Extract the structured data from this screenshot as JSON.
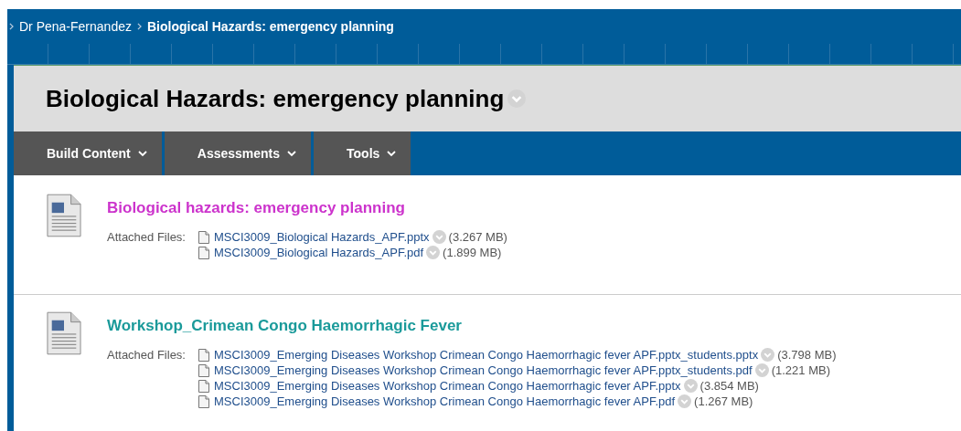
{
  "breadcrumb": [
    {
      "label": "Dr Pena-Fernandez",
      "selected": false
    },
    {
      "label": "Biological Hazards: emergency planning",
      "selected": true
    }
  ],
  "page_title": "Biological Hazards: emergency planning",
  "toolbar": [
    "Build Content",
    "Assessments",
    "Tools"
  ],
  "items": [
    {
      "title": "Biological hazards: emergency planning",
      "color": "#cc33cc",
      "files_label": "Attached Files:",
      "files": [
        {
          "name": "MSCI3009_Biological Hazards_APF.pptx",
          "size": "(3.267 MB)"
        },
        {
          "name": "MSCI3009_Biological Hazards_APF.pdf",
          "size": "(1.899 MB)"
        }
      ]
    },
    {
      "title": "Workshop_Crimean Congo Haemorrhagic Fever",
      "color": "#1a9a9a",
      "files_label": "Attached Files:",
      "files": [
        {
          "name": "MSCI3009_Emerging Diseases Workshop Crimean Congo Haemorrhagic fever APF.pptx_students.pptx",
          "size": "(3.798 MB)"
        },
        {
          "name": "MSCI3009_Emerging Diseases Workshop Crimean Congo Haemorrhagic fever APF.pptx_students.pdf",
          "size": "(1.221 MB)"
        },
        {
          "name": "MSCI3009_Emerging Diseases Workshop Crimean Congo Haemorrhagic fever APF.pptx",
          "size": "(3.854 MB)"
        },
        {
          "name": "MSCI3009_Emerging Diseases Workshop Crimean Congo Haemorrhagic fever APF.pdf",
          "size": "(1.267 MB)"
        }
      ]
    }
  ]
}
